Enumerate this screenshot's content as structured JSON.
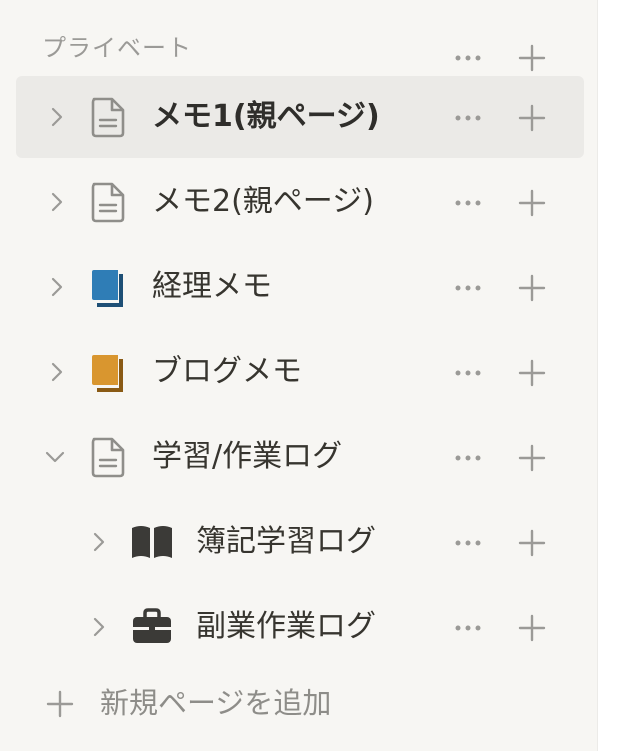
{
  "sidebar": {
    "section_title": "プライベート",
    "items": [
      {
        "label": "メモ1(親ページ)",
        "icon": "document-icon",
        "expanded": false,
        "selected": true
      },
      {
        "label": "メモ2(親ページ)",
        "icon": "document-icon",
        "expanded": false,
        "selected": false
      },
      {
        "label": "経理メモ",
        "icon": "blue-notebook-icon",
        "expanded": false,
        "selected": false,
        "icon_color": "#2f7db6"
      },
      {
        "label": "ブログメモ",
        "icon": "orange-notebook-icon",
        "expanded": false,
        "selected": false,
        "icon_color": "#d9962f"
      },
      {
        "label": "学習/作業ログ",
        "icon": "document-icon",
        "expanded": true,
        "selected": false,
        "children": [
          {
            "label": "簿記学習ログ",
            "icon": "open-book-icon",
            "expanded": false
          },
          {
            "label": "副業作業ログ",
            "icon": "briefcase-icon",
            "expanded": false
          }
        ]
      }
    ],
    "add_page_label": "新規ページを追加"
  },
  "colors": {
    "sidebar_bg": "#f7f6f3",
    "selected_bg": "#ebeae7",
    "muted_text": "#9b9a97",
    "icon_gray": "#8f8e8a"
  }
}
